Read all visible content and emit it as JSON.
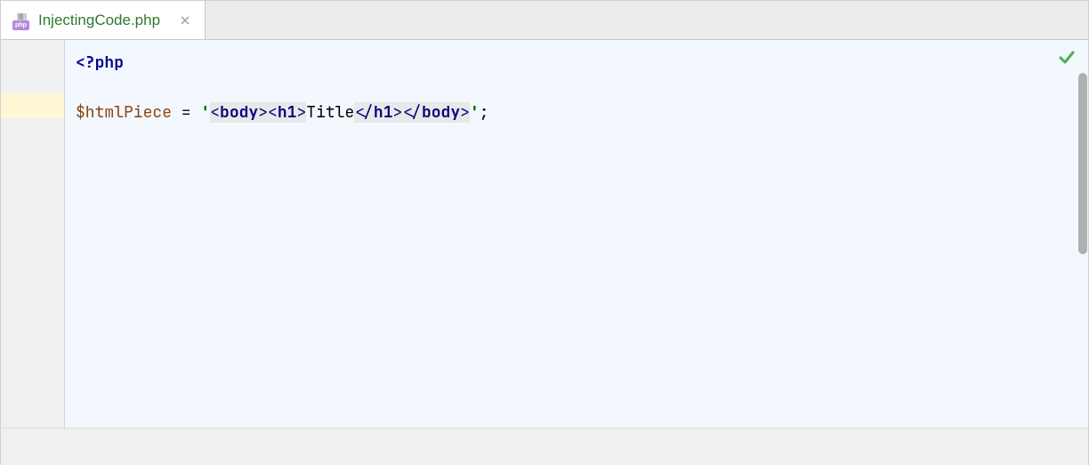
{
  "tab": {
    "filename": "InjectingCode.php",
    "badge": "php"
  },
  "code": {
    "line1": {
      "open_tag": "<?php"
    },
    "line3": {
      "var": "$htmlPiece",
      "eq": " = ",
      "quote1": "'",
      "b1_open": "<",
      "b1_tag": "body",
      "b1_close": ">",
      "b2_open": "<",
      "b2_tag": "h1",
      "b2_close": ">",
      "text": "Title",
      "b3_open": "<",
      "b3_slash": "/",
      "b3_tag": "h1",
      "b3_close": ">",
      "b4_open": "<",
      "b4_slash": "/",
      "b4_tag": "body",
      "b4_close": ">",
      "quote2": "'",
      "semi": ";"
    }
  }
}
